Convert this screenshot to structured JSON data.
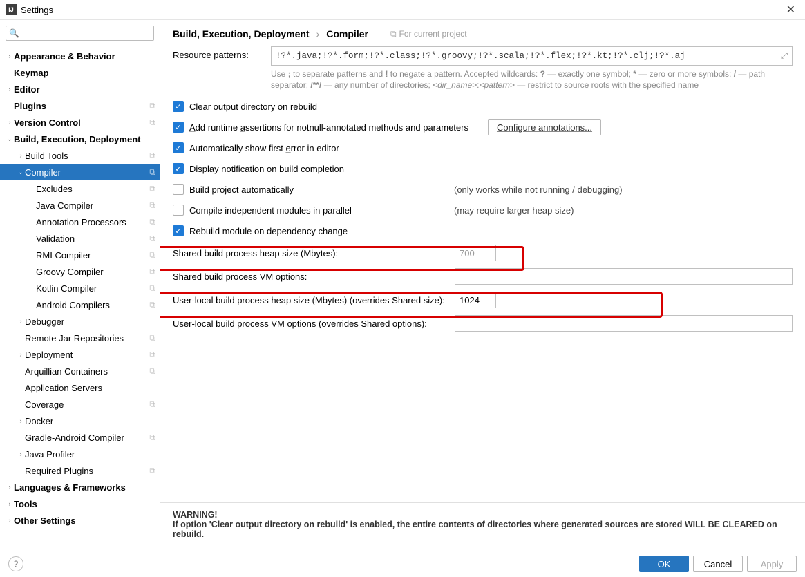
{
  "window": {
    "title": "Settings"
  },
  "search": {
    "placeholder": ""
  },
  "sidebar": [
    {
      "label": "Appearance & Behavior",
      "level": 0,
      "bold": true,
      "arrow": "right",
      "copy": false
    },
    {
      "label": "Keymap",
      "level": 0,
      "bold": true,
      "arrow": "",
      "copy": false
    },
    {
      "label": "Editor",
      "level": 0,
      "bold": true,
      "arrow": "right",
      "copy": false
    },
    {
      "label": "Plugins",
      "level": 0,
      "bold": true,
      "arrow": "",
      "copy": true
    },
    {
      "label": "Version Control",
      "level": 0,
      "bold": true,
      "arrow": "right",
      "copy": true
    },
    {
      "label": "Build, Execution, Deployment",
      "level": 0,
      "bold": true,
      "arrow": "down",
      "copy": false
    },
    {
      "label": "Build Tools",
      "level": 1,
      "bold": false,
      "arrow": "right",
      "copy": true
    },
    {
      "label": "Compiler",
      "level": 1,
      "bold": false,
      "arrow": "down",
      "copy": true,
      "selected": true
    },
    {
      "label": "Excludes",
      "level": 2,
      "bold": false,
      "arrow": "",
      "copy": true
    },
    {
      "label": "Java Compiler",
      "level": 2,
      "bold": false,
      "arrow": "",
      "copy": true
    },
    {
      "label": "Annotation Processors",
      "level": 2,
      "bold": false,
      "arrow": "",
      "copy": true
    },
    {
      "label": "Validation",
      "level": 2,
      "bold": false,
      "arrow": "",
      "copy": true
    },
    {
      "label": "RMI Compiler",
      "level": 2,
      "bold": false,
      "arrow": "",
      "copy": true
    },
    {
      "label": "Groovy Compiler",
      "level": 2,
      "bold": false,
      "arrow": "",
      "copy": true
    },
    {
      "label": "Kotlin Compiler",
      "level": 2,
      "bold": false,
      "arrow": "",
      "copy": true
    },
    {
      "label": "Android Compilers",
      "level": 2,
      "bold": false,
      "arrow": "",
      "copy": true
    },
    {
      "label": "Debugger",
      "level": 1,
      "bold": false,
      "arrow": "right",
      "copy": false
    },
    {
      "label": "Remote Jar Repositories",
      "level": 1,
      "bold": false,
      "arrow": "",
      "copy": true
    },
    {
      "label": "Deployment",
      "level": 1,
      "bold": false,
      "arrow": "right",
      "copy": true
    },
    {
      "label": "Arquillian Containers",
      "level": 1,
      "bold": false,
      "arrow": "",
      "copy": true
    },
    {
      "label": "Application Servers",
      "level": 1,
      "bold": false,
      "arrow": "",
      "copy": false
    },
    {
      "label": "Coverage",
      "level": 1,
      "bold": false,
      "arrow": "",
      "copy": true
    },
    {
      "label": "Docker",
      "level": 1,
      "bold": false,
      "arrow": "right",
      "copy": false
    },
    {
      "label": "Gradle-Android Compiler",
      "level": 1,
      "bold": false,
      "arrow": "",
      "copy": true
    },
    {
      "label": "Java Profiler",
      "level": 1,
      "bold": false,
      "arrow": "right",
      "copy": false
    },
    {
      "label": "Required Plugins",
      "level": 1,
      "bold": false,
      "arrow": "",
      "copy": true
    },
    {
      "label": "Languages & Frameworks",
      "level": 0,
      "bold": true,
      "arrow": "right",
      "copy": false
    },
    {
      "label": "Tools",
      "level": 0,
      "bold": true,
      "arrow": "right",
      "copy": false
    },
    {
      "label": "Other Settings",
      "level": 0,
      "bold": true,
      "arrow": "right",
      "copy": false
    }
  ],
  "breadcrumb": {
    "a": "Build, Execution, Deployment",
    "b": "Compiler",
    "hint": "For current project"
  },
  "patterns": {
    "label": "Resource patterns:",
    "value": "!?*.java;!?*.form;!?*.class;!?*.groovy;!?*.scala;!?*.flex;!?*.kt;!?*.clj;!?*.aj",
    "hint_html": "Use <b>;</b> to separate patterns and <b>!</b> to negate a pattern. Accepted wildcards: <b>?</b> — exactly one symbol; <b>*</b> — zero or more symbols; <b>/</b> — path separator; <b>/**/</b> — any number of directories; <i>&lt;dir_name&gt;</i>:<i>&lt;pattern&gt;</i> — restrict to source roots with the specified name"
  },
  "checks": {
    "clear": {
      "label": "Clear output directory on rebuild",
      "on": true
    },
    "assert": {
      "label": "Add runtime assertions for notnull-annotated methods and parameters",
      "on": true
    },
    "auto_err": {
      "label": "Automatically show first error in editor",
      "on": true
    },
    "notify": {
      "label": "Display notification on build completion",
      "on": true
    },
    "auto_build": {
      "label": "Build project automatically",
      "on": false,
      "note": "(only works while not running / debugging)"
    },
    "parallel": {
      "label": "Compile independent modules in parallel",
      "on": false,
      "note": "(may require larger heap size)"
    },
    "rebuild_dep": {
      "label": "Rebuild module on dependency change",
      "on": true
    }
  },
  "configure_btn": "Configure annotations...",
  "fields": {
    "shared_heap": {
      "label": "Shared build process heap size (Mbytes):",
      "value": "700",
      "disabled": true
    },
    "shared_vm": {
      "label": "Shared build process VM options:",
      "value": ""
    },
    "user_heap": {
      "label": "User-local build process heap size (Mbytes) (overrides Shared size):",
      "value": "1024"
    },
    "user_vm": {
      "label": "User-local build process VM options (overrides Shared options):",
      "value": ""
    }
  },
  "warning": {
    "title": "WARNING!",
    "text": "If option 'Clear output directory on rebuild' is enabled, the entire contents of directories where generated sources are stored WILL BE CLEARED on rebuild."
  },
  "footer": {
    "ok": "OK",
    "cancel": "Cancel",
    "apply": "Apply"
  }
}
